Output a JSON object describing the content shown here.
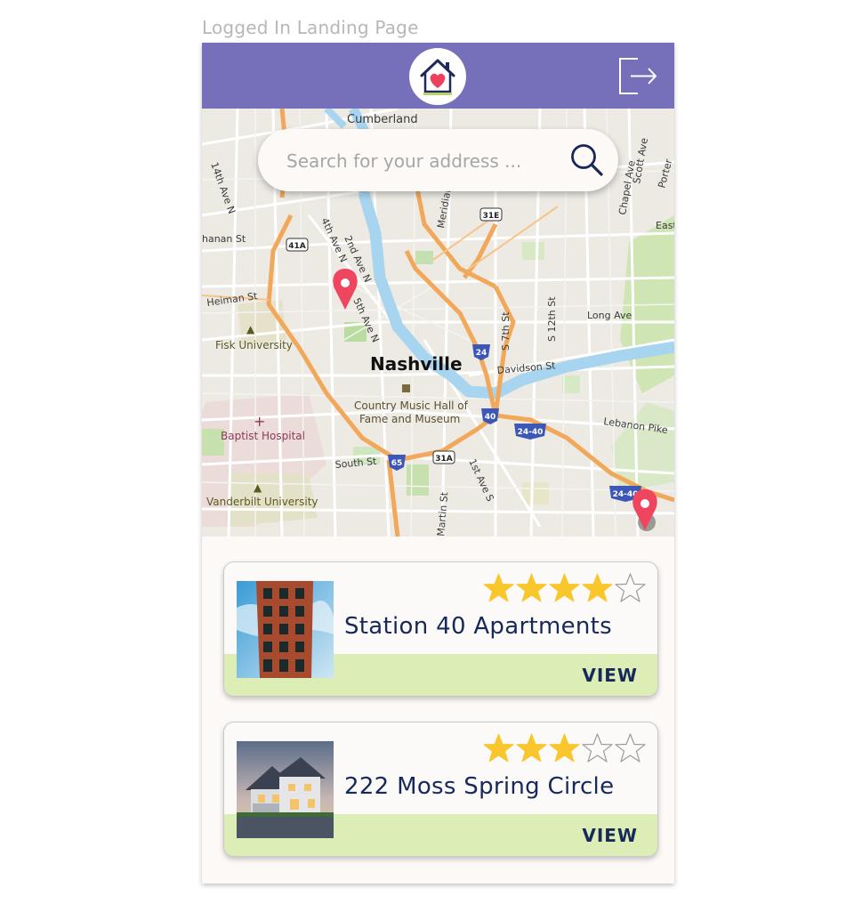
{
  "frame_label": "Logged In Landing Page",
  "header": {
    "logo_icon": "house-heart-icon",
    "logout_icon": "logout-icon",
    "bar_color": "#7670ba"
  },
  "search": {
    "placeholder": "Search for your address ...",
    "value": "",
    "icon": "search-icon"
  },
  "map": {
    "city_label": "Nashville",
    "labels": {
      "cumberland": "Cumberland",
      "fisk": "Fisk University",
      "baptist": "Baptist Hospital",
      "vanderbilt": "Vanderbilt University",
      "music_hall_1": "Country Music Hall of",
      "music_hall_2": "Fame and Museum",
      "heiman": "Heiman St",
      "hanan": "hanan St",
      "fourteenth": "14th Ave N",
      "fourth": "4th Ave N",
      "second": "2nd Ave N",
      "fifth": "5th Ave N",
      "davidson": "Davidson St",
      "long": "Long Ave",
      "lebanon": "Lebanon Pike",
      "s7th": "S 7th St",
      "s12th": "S 12th St",
      "south": "South St",
      "first_s": "1st Ave S",
      "martin": "Martin St",
      "meridian": "Meridian",
      "scott": "Scott Ave",
      "chapel": "Chapel Ave",
      "porter": "Porter",
      "east": "East",
      "shield_41a": "41A",
      "shield_31e": "31E",
      "shield_31a": "31A",
      "shield_24": "24",
      "shield_40": "40",
      "shield_65": "65",
      "shield_24_40": "24-40",
      "shield_24_40b": "24-40"
    },
    "pin_color": "#f0455e"
  },
  "listings": [
    {
      "title": "Station 40 Apartments",
      "rating": 4,
      "max_rating": 5,
      "view_label": "VIEW"
    },
    {
      "title": "222 Moss Spring Circle",
      "rating": 3,
      "max_rating": 5,
      "view_label": "VIEW"
    }
  ],
  "colors": {
    "star": "#f9c62b",
    "view_bar": "#dceeb6",
    "title_text": "#16295a"
  }
}
